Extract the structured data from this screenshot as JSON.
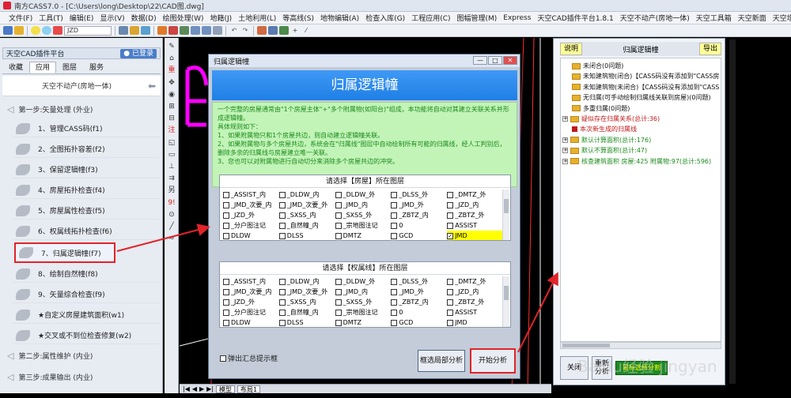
{
  "window": {
    "title": "南方CASS7.0 - [C:\\Users\\long\\Desktop\\22\\CAD图.dwg]"
  },
  "menu": [
    "文件(F)",
    "工具(T)",
    "编辑(E)",
    "显示(V)",
    "数据(D)",
    "绘图处理(W)",
    "地籍(J)",
    "土地利用(L)",
    "等高线(S)",
    "地物编辑(A)",
    "检查入库(G)",
    "工程应用(C)",
    "图幅管理(M)",
    "Express",
    "天空CAD插件平台1.8.1",
    "天空不动产(房地一体)",
    "天空工具箱",
    "天空新面",
    "天空增减挂报备"
  ],
  "toolbar": {
    "layer_text": "JZD"
  },
  "left_panel": {
    "title": "天空CAD插件平台",
    "login": "已登录",
    "tabs": [
      "收藏",
      "应用",
      "图层",
      "服务"
    ],
    "subheader": "天空不动产(房地一体)",
    "step1": "第一步:矢量处理 (外业)",
    "items": [
      "1、管理CASS码(f1)",
      "2、全图拓扑容差(f2)",
      "3、保留逻辑幢(f3)",
      "4、房屋拓扑检查(f4)",
      "5、房屋属性检查(f5)",
      "6、权属线拓扑检查(f6)",
      "7、归属逻辑幢(f7)",
      "8、绘制自然幢(f8)",
      "9、矢量综合检查(f9)",
      "★自定义房屋建筑面积(w1)",
      "★交叉或不到位检查修复(w2)"
    ],
    "step2": "第二步:属性维护 (内业)",
    "step3": "第三步:成果输出 (内业)"
  },
  "vertical_tools": [
    "✎",
    "⌂",
    "重",
    "✥",
    "◉",
    "⊞",
    "⊟",
    "注",
    "◱",
    "▭",
    "⊥",
    "⇉",
    "另",
    "9!",
    "⊙",
    "╱",
    "≈"
  ],
  "dialog": {
    "window_title": "归属逻辑幢",
    "header": "归属逻辑幢",
    "description": [
      "一个完整的房屋通常由\"1个房屋主体\"+\"多个附属物(如阳台)\"组成，本功能将自动对其建立关联关系并形成逻辑幢。",
      "具体规则如下：",
      "1、如果附属物只和1个房屋共边，则自动建立逻辑幢关联。",
      "2、如果附属物与多个房屋共边，系统会在\"归属线\"图层中自动绘制所有可能的归属线，经人工判别后，删除多余的归属线与房屋建立唯一关联。",
      "3、您也可以对附属物进行自动切分来消除多个房屋共边的冲突。"
    ],
    "group1": {
      "title": "请选择【房屋】所在图层",
      "layers": [
        "_ASSIST_内",
        "_DLDW_内",
        "_DLDW_外",
        "_DLSS_外",
        "_DMTZ_外",
        "_JMD_次要_内",
        "_JMD_次要_外",
        "_JMD_内",
        "_JMD_外",
        "_JZD_内",
        "_JZD_外",
        "_SXSS_内",
        "_SXSS_外",
        "_ZBTZ_内",
        "_ZBTZ_外",
        "_分户图注记",
        "_自然幢_内",
        "_宗地图注记",
        "0",
        "ASSIST",
        "DLDW",
        "DLSS",
        "DMTZ",
        "GCD",
        "JMD"
      ],
      "checked": "JMD"
    },
    "group2": {
      "title": "请选择【权属线】所在图层",
      "layers": [
        "_ASSIST_内",
        "_DLDW_内",
        "_DLDW_外",
        "_DLSS_外",
        "_DMTZ_外",
        "_JMD_次要_内",
        "_JMD_次要_外",
        "_JMD_内",
        "_JMD_外",
        "_JZD_内",
        "_JZD_外",
        "_SXSS_内",
        "_SXSS_外",
        "_ZBTZ_内",
        "_ZBTZ_外",
        "_分户图注记",
        "_自然幢_内",
        "_宗地图注记",
        "0",
        "ASSIST",
        "DLDW",
        "DLSS",
        "DMTZ",
        "GCD",
        "JMD"
      ]
    },
    "popup_label": "弹出汇总提示框",
    "btn_local": "框选局部分析",
    "btn_start": "开始分析"
  },
  "right_panel": {
    "btn_help": "说明",
    "title": "归属逻辑幢",
    "btn_export": "导出",
    "tree": [
      {
        "label": "未闭合(0问题)",
        "type": "folder",
        "indent": 1,
        "color": "blk"
      },
      {
        "label": "未知建筑物(闭合)【CASS码没有添加到\"CASS房",
        "type": "folder",
        "indent": 1,
        "color": "blk"
      },
      {
        "label": "未知建筑物(未闭合)【CASS码没有添加到\"CASS",
        "type": "folder",
        "indent": 1,
        "color": "blk"
      },
      {
        "label": "无归属(可手动绘制归属线关联到房屋)(0问题)",
        "type": "folder",
        "indent": 1,
        "color": "blk"
      },
      {
        "label": "多重归属(0问题)",
        "type": "folder",
        "indent": 1,
        "color": "blk"
      },
      {
        "label": "疑似存在归属关系(总计:36)",
        "type": "toggle",
        "indent": 0,
        "color": "red"
      },
      {
        "label": "本次新生成的归属线",
        "type": "dot",
        "indent": 1,
        "color": "red"
      },
      {
        "label": "默认计算面积(总计:176)",
        "type": "toggle",
        "indent": 0,
        "color": "green"
      },
      {
        "label": "默认不算面积(总计:47)",
        "type": "toggle",
        "indent": 0,
        "color": "green"
      },
      {
        "label": "核查建筑面积 房屋:425 附属物:97(总计:596)",
        "type": "toggle",
        "indent": 0,
        "color": "green"
      }
    ],
    "btn_close": "关闭",
    "btn_reanalyze": "重新分析",
    "btn_select": "鼠标选择分割"
  },
  "bottom_tabs": [
    "模型",
    "布局1"
  ],
  "watermark": "Baidu经验 jingyan"
}
